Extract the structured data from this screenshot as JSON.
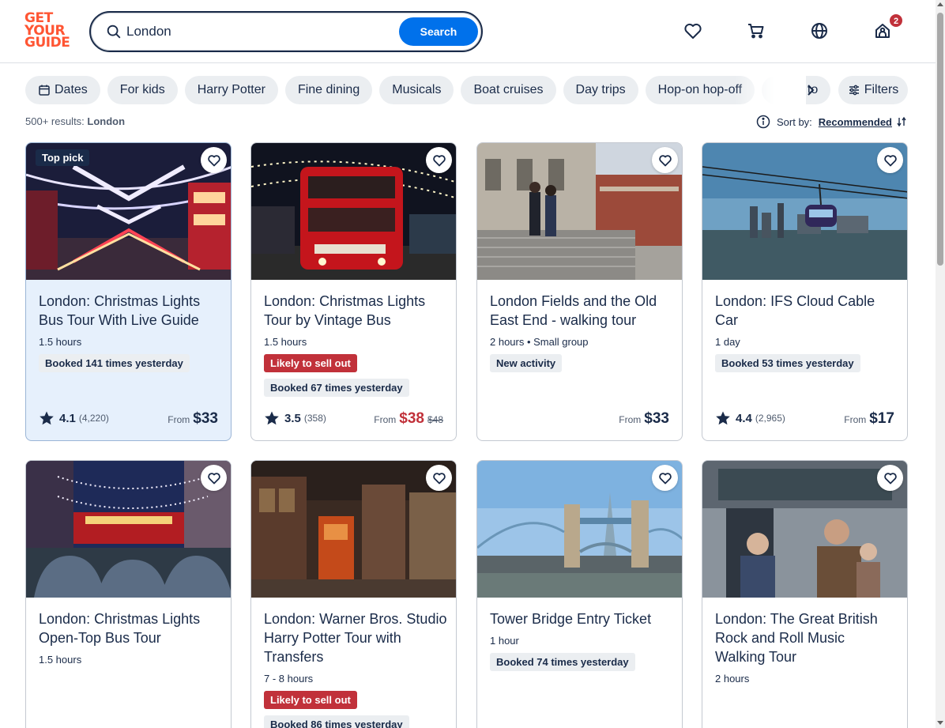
{
  "brand": {
    "line1": "GET",
    "line2": "YOUR",
    "line3": "GUIDE",
    "color": "#ff5533"
  },
  "search": {
    "value": "London",
    "button_label": "Search"
  },
  "header_icons": [
    "heart-icon",
    "cart-icon",
    "globe-icon",
    "profile-icon"
  ],
  "notification_count": "2",
  "chips": [
    "Dates",
    "For kids",
    "Harry Potter",
    "Fine dining",
    "Musicals",
    "Boat cruises",
    "Day trips",
    "Hop-on hop-off",
    "Night to"
  ],
  "filters_label": "Filters",
  "results": {
    "count": "500+ results:",
    "location": "London"
  },
  "sort": {
    "label": "Sort by:",
    "value": "Recommended"
  },
  "colors": {
    "accent": "#0071eb",
    "danger": "#c1313a",
    "text": "#1a2b49",
    "highlight_bg": "#e6f0fc"
  },
  "cards": [
    {
      "badge": "Top pick",
      "title": "London: Christmas Lights Bus Tour With Live Guide",
      "meta": "1.5 hours",
      "tags": [
        {
          "kind": "booked",
          "text": "Booked 141 times yesterday"
        }
      ],
      "rating": "4.1",
      "reviews": "(4,220)",
      "from": "From",
      "price": "$33"
    },
    {
      "title": "London: Christmas Lights Tour by Vintage Bus",
      "meta": "1.5 hours",
      "tags": [
        {
          "kind": "sell",
          "text": "Likely to sell out"
        },
        {
          "kind": "booked",
          "text": "Booked 67 times yesterday"
        }
      ],
      "rating": "3.5",
      "reviews": "(358)",
      "from": "From",
      "price": "$38",
      "old_price": "$48"
    },
    {
      "title": "London Fields and the Old East End - walking tour",
      "meta": "2 hours • Small group",
      "tags": [
        {
          "kind": "new",
          "text": "New activity"
        }
      ],
      "from": "From",
      "price": "$33"
    },
    {
      "title": "London: IFS Cloud Cable Car",
      "meta": "1 day",
      "tags": [
        {
          "kind": "booked",
          "text": "Booked 53 times yesterday"
        }
      ],
      "rating": "4.4",
      "reviews": "(2,965)",
      "from": "From",
      "price": "$17"
    },
    {
      "title": "London: Christmas Lights Open-Top Bus Tour",
      "meta": "1.5 hours",
      "tags": []
    },
    {
      "title": "London: Warner Bros. Studio Harry Potter Tour with Transfers",
      "meta": "7 - 8 hours",
      "tags": [
        {
          "kind": "sell",
          "text": "Likely to sell out"
        },
        {
          "kind": "booked",
          "text": "Booked 86 times yesterday"
        }
      ]
    },
    {
      "title": "Tower Bridge Entry Ticket",
      "meta": "1 hour",
      "tags": [
        {
          "kind": "booked",
          "text": "Booked 74 times yesterday"
        }
      ]
    },
    {
      "title": "London: The Great British Rock and Roll Music Walking Tour",
      "meta": "2 hours",
      "tags": []
    }
  ]
}
